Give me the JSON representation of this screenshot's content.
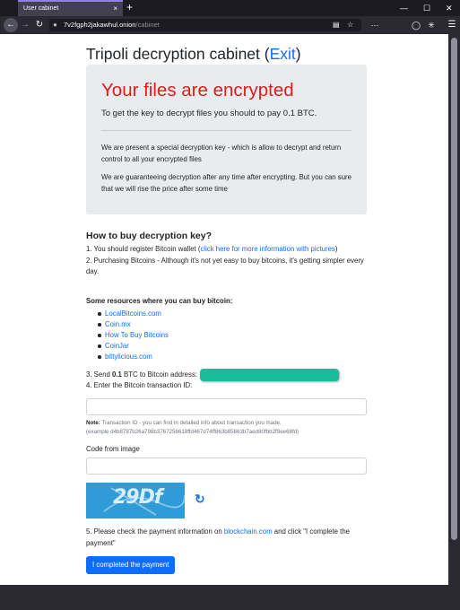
{
  "browser": {
    "tab_title": "User cabinet",
    "tab_close": "×",
    "new_tab": "+",
    "win_min": "—",
    "win_max": "☐",
    "win_close": "✕",
    "url_host": "7v2fgph2jakawhul.onion",
    "url_path": "/cabinet"
  },
  "page": {
    "title_prefix": "Tripoli decryption cabinet (",
    "exit_link": "Exit",
    "title_suffix": ")",
    "headline": "Your files are encrypted",
    "lead": "To get the key to decrypt files you should to pay 0.1 BTC.",
    "para1": "We are present a special decryption key - which is allow to decrypt and return control to all your encrypted files",
    "para2": "We are guaranteeing decryption after any time after encrypting. But you can sure that we will rise the price after some time",
    "howto_heading": "How to buy decryption key?",
    "step1_prefix": "1. You should register Bitcoin wallet (",
    "step1_link": "click here for more information with pictures",
    "step1_suffix": ")",
    "step2": "2. Purchasing Bitcoins - Although it's not yet easy to buy bitcoins, it's getting simpler every day.",
    "resources_heading": "Some resources where you can buy bitcoin:",
    "resources": [
      "LocalBitcoins.com",
      "Coin.mx",
      "How To Buy Bitcoins",
      "CoinJar",
      "bittylicious.com"
    ],
    "step3_prefix": "3. Send ",
    "step3_amount": "0.1",
    "step3_suffix": " BTC to Bitcoin address:",
    "step4": "4. Enter the Bitcoin transaction ID:",
    "note_label": "Note:",
    "note_text": " Transaction ID - you can find in detailed info about transaction you made.",
    "note_example": "(example d4b8787b26a798b3767256618ffd467d74ff863b85663b7aed80fbb2f9ee68fd)",
    "code_label": "Code from image",
    "captcha_text": "29Df",
    "step5_prefix": "5. Please check the payment information on ",
    "step5_link": "blockchain.com",
    "step5_suffix": " and click \"I complete the payment\"",
    "submit_button": "I completed the payment"
  },
  "colors": {
    "headline": "#e21b1b",
    "link": "#0d6efd",
    "btc_address_bg": "#1abc9c",
    "captcha_bg": "#2f9bd7"
  }
}
